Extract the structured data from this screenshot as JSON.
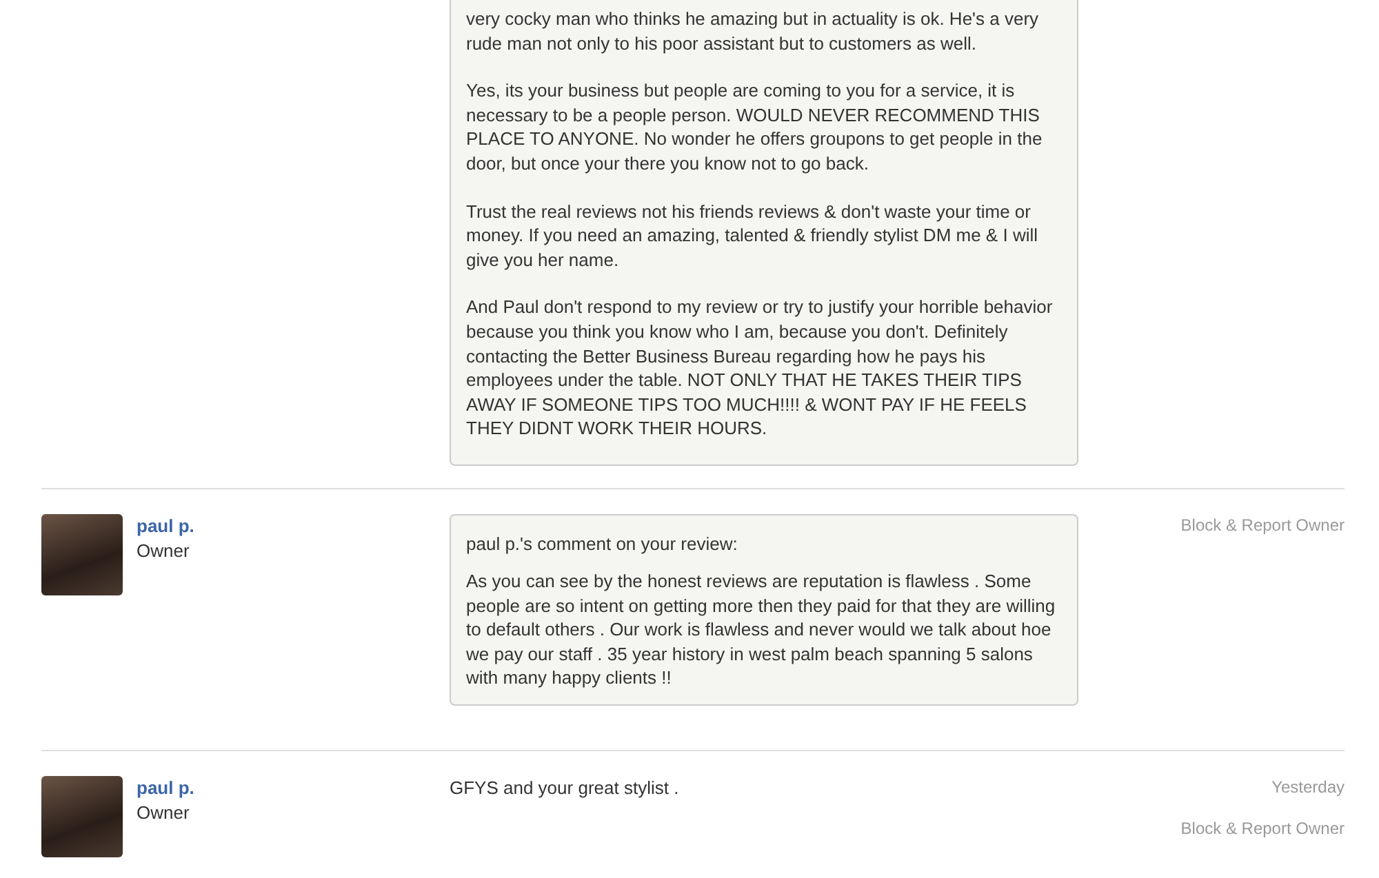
{
  "review": {
    "paragraphs": [
      "very cocky man who thinks he amazing but in actuality is ok.  He's a very rude man not only to his poor assistant but to customers as well.",
      "Yes, its your business but people are coming to you for a service, it is necessary to be a people person.  WOULD NEVER RECOMMEND THIS PLACE TO ANYONE. No wonder he offers groupons to get people in the door, but once your there you know not to go back.",
      "Trust the real reviews not his friends reviews & don't waste your time or money.  If you need an amazing, talented & friendly stylist DM me & I will give you her name.",
      "And Paul don't respond to my review or try to justify your horrible behavior because you think you know who I am, because you don't. Definitely contacting the Better Business Bureau regarding how he pays his employees under the table. NOT ONLY THAT HE TAKES THEIR TIPS AWAY IF SOMEONE TIPS TOO MUCH!!!! & WONT PAY IF HE FEELS THEY DIDNT WORK THEIR HOURS."
    ]
  },
  "comments": [
    {
      "kind": "boxed",
      "name": "paul p.",
      "role": "Owner",
      "heading": "paul p.'s comment on your review:",
      "body": "As you can see by the honest reviews are reputation is flawless . Some people are so intent on getting more then they paid for that they are willing to default others . Our work is flawless and never would we talk about hoe we pay our staff . 35 year history in west palm beach spanning 5 salons with many happy clients !!",
      "action": "Block & Report Owner"
    },
    {
      "kind": "plain",
      "name": "paul p.",
      "role": "Owner",
      "body": "GFYS and your great stylist .",
      "time": "Yesterday",
      "action": "Block & Report Owner"
    }
  ]
}
